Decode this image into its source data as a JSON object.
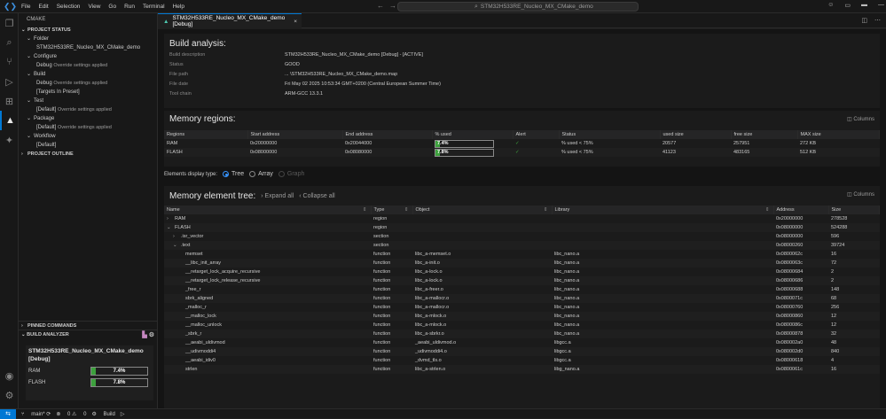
{
  "titlebar": {
    "menu": [
      "File",
      "Edit",
      "Selection",
      "View",
      "Go",
      "Run",
      "Terminal",
      "Help"
    ],
    "search": "STM32H533RE_Nucleo_MX_CMake_demo"
  },
  "sidebar": {
    "title": "CMAKE",
    "project_status": "PROJECT STATUS",
    "items": [
      {
        "label": "Folder",
        "indent": 1
      },
      {
        "label": "STM32H533RE_Nucleo_MX_CMake_demo",
        "indent": 2
      },
      {
        "label": "Configure",
        "indent": 1
      },
      {
        "label": "Debug",
        "sub": "Override settings applied",
        "indent": 2
      },
      {
        "label": "Build",
        "indent": 1
      },
      {
        "label": "Debug",
        "sub": "Override settings applied",
        "indent": 2
      },
      {
        "label": "[Targets In Preset]",
        "indent": 2
      },
      {
        "label": "Test",
        "indent": 1
      },
      {
        "label": "[Default]",
        "sub": "Override settings applied",
        "indent": 2
      },
      {
        "label": "Package",
        "indent": 1
      },
      {
        "label": "[Default]",
        "sub": "Override settings applied",
        "indent": 2
      },
      {
        "label": "Workflow",
        "indent": 1
      },
      {
        "label": "[Default]",
        "indent": 2
      }
    ],
    "project_outline": "PROJECT OUTLINE",
    "pinned": "PINNED COMMANDS",
    "build_analyzer": "BUILD ANALYZER",
    "card": {
      "title": "STM32H533RE_Nucleo_MX_CMake_demo [Debug]",
      "regions": [
        {
          "name": "RAM",
          "used": "7.4%",
          "fraction": 0.074
        },
        {
          "name": "FLASH",
          "used": "7.8%",
          "fraction": 0.078
        }
      ]
    }
  },
  "tab": {
    "label": "STM32H533RE_Nucleo_MX_CMake_demo [Debug]"
  },
  "build": {
    "title": "Build analysis:",
    "rows": [
      {
        "k": "Build description",
        "v": "STM32H533RE_Nucleo_MX_CMake_demo [Debug] - [ACTIVE]"
      },
      {
        "k": "Status",
        "v": "GOOD"
      },
      {
        "k": "File path",
        "v": "... \\STM32H533RE_Nucleo_MX_CMake_demo.map"
      },
      {
        "k": "File date",
        "v": "Fri May 02 2025 10:53:34 GMT+0200 (Central European Summer Time)"
      },
      {
        "k": "Tool chain",
        "v": "ARM-GCC 13.3.1"
      }
    ]
  },
  "memory": {
    "title": "Memory regions:",
    "columns_btn": "Columns",
    "headers": [
      "Regions",
      "Start address",
      "End address",
      "% used",
      "Alert",
      "Status",
      "used size",
      "free size",
      "MAX size"
    ],
    "rows": [
      {
        "region": "RAM",
        "start": "0x20000000",
        "end": "0x20044000",
        "used": "7.4%",
        "fraction": 0.074,
        "status": "% used < 75%",
        "used_size": "20577",
        "free": "257951",
        "max": "272 KB"
      },
      {
        "region": "FLASH",
        "start": "0x08000000",
        "end": "0x08080000",
        "used": "7.8%",
        "fraction": 0.078,
        "status": "% used < 75%",
        "used_size": "41123",
        "free": "483165",
        "max": "512 KB"
      }
    ]
  },
  "display": {
    "label": "Elements display type:",
    "options": [
      "Tree",
      "Array",
      "Graph"
    ]
  },
  "tree": {
    "title": "Memory element tree:",
    "expand": "Expand all",
    "collapse": "Collapse all",
    "columns_btn": "Columns",
    "headers": [
      "Name",
      "Type",
      "Object",
      "Library",
      "Address",
      "Size"
    ],
    "rows": [
      {
        "name": "RAM",
        "type": "region",
        "object": "",
        "library": "",
        "address": "0x20000000",
        "size": "278528",
        "level": 0,
        "exp": ">"
      },
      {
        "name": "FLASH",
        "type": "region",
        "object": "",
        "library": "",
        "address": "0x08000000",
        "size": "524288",
        "level": 0,
        "exp": "v"
      },
      {
        "name": ".isr_vector",
        "type": "section",
        "object": "",
        "library": "",
        "address": "0x08000000",
        "size": "596",
        "level": 1,
        "exp": ">"
      },
      {
        "name": ".text",
        "type": "section",
        "object": "",
        "library": "",
        "address": "0x08000260",
        "size": "39724",
        "level": 1,
        "exp": "v"
      },
      {
        "name": "memset",
        "type": "function",
        "object": "libc_a-memset.o",
        "library": "libc_nano.a",
        "address": "0x0800062c",
        "size": "16",
        "level": 2
      },
      {
        "name": "__libc_init_array",
        "type": "function",
        "object": "libc_a-init.o",
        "library": "libc_nano.a",
        "address": "0x0800063c",
        "size": "72",
        "level": 2
      },
      {
        "name": "__retarget_lock_acquire_recursive",
        "type": "function",
        "object": "libc_a-lock.o",
        "library": "libc_nano.a",
        "address": "0x08000684",
        "size": "2",
        "level": 2
      },
      {
        "name": "__retarget_lock_release_recursive",
        "type": "function",
        "object": "libc_a-lock.o",
        "library": "libc_nano.a",
        "address": "0x08000686",
        "size": "2",
        "level": 2
      },
      {
        "name": "_free_r",
        "type": "function",
        "object": "libc_a-freer.o",
        "library": "libc_nano.a",
        "address": "0x08000688",
        "size": "148",
        "level": 2
      },
      {
        "name": "sbrk_aligned",
        "type": "function",
        "object": "libc_a-mallocr.o",
        "library": "libc_nano.a",
        "address": "0x0800071c",
        "size": "68",
        "level": 2
      },
      {
        "name": "_malloc_r",
        "type": "function",
        "object": "libc_a-mallocr.o",
        "library": "libc_nano.a",
        "address": "0x08000760",
        "size": "256",
        "level": 2
      },
      {
        "name": "__malloc_lock",
        "type": "function",
        "object": "libc_a-mlock.o",
        "library": "libc_nano.a",
        "address": "0x08000860",
        "size": "12",
        "level": 2
      },
      {
        "name": "__malloc_unlock",
        "type": "function",
        "object": "libc_a-mlock.o",
        "library": "libc_nano.a",
        "address": "0x0800086c",
        "size": "12",
        "level": 2
      },
      {
        "name": "_sbrk_r",
        "type": "function",
        "object": "libc_a-sbrkr.o",
        "library": "libc_nano.a",
        "address": "0x08000878",
        "size": "32",
        "level": 2
      },
      {
        "name": "__aeabi_uldivmod",
        "type": "function",
        "object": "_aeabi_uldivmod.o",
        "library": "libgcc.a",
        "address": "0x080002a0",
        "size": "48",
        "level": 2
      },
      {
        "name": "__udivmoddi4",
        "type": "function",
        "object": "_udivmoddi4.o",
        "library": "libgcc.a",
        "address": "0x080002d0",
        "size": "840",
        "level": 2
      },
      {
        "name": "__aeabi_idiv0",
        "type": "function",
        "object": "_dvmd_tls.o",
        "library": "libgcc.a",
        "address": "0x08000618",
        "size": "4",
        "level": 2
      },
      {
        "name": "strlen",
        "type": "function",
        "object": "libc_a-strlen.o",
        "library": "libg_nano.a",
        "address": "0x0800061c",
        "size": "16",
        "level": 2
      }
    ]
  },
  "statusbar": {
    "branch": "main*",
    "problems": "0",
    "warnings": "0",
    "build": "Build"
  }
}
